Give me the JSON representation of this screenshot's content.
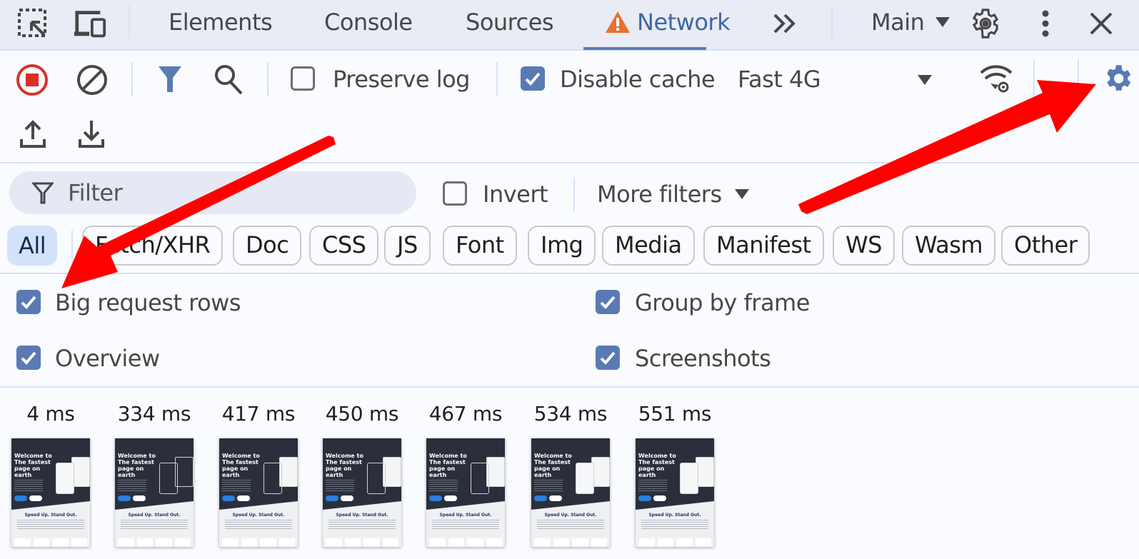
{
  "topbar": {
    "tabs": [
      {
        "label": "Elements",
        "active": false
      },
      {
        "label": "Console",
        "active": false
      },
      {
        "label": "Sources",
        "active": false
      },
      {
        "label": "Network",
        "active": true,
        "has_warning": true
      }
    ],
    "more_tabs_icon": "chevrons-right-icon",
    "target_dropdown": "Main",
    "icons": [
      "inspect-element-icon",
      "device-toolbar-icon",
      "settings-icon",
      "more-vert-icon",
      "close-icon"
    ]
  },
  "toolbar": {
    "record_icon": "stop-recording-icon",
    "clear_icon": "clear-icon",
    "filter_icon": "filter-icon",
    "search_icon": "search-icon",
    "preserve_log": {
      "label": "Preserve log",
      "checked": false
    },
    "disable_cache": {
      "label": "Disable cache",
      "checked": true
    },
    "throttling": {
      "value": "Fast 4G"
    },
    "network_conditions_icon": "wifi-settings-icon",
    "network_settings_icon": "gear-icon",
    "import_icon": "upload-icon",
    "export_icon": "download-icon"
  },
  "filters": {
    "filter_placeholder": "Filter",
    "invert": {
      "label": "Invert",
      "checked": false
    },
    "more_filters": "More filters",
    "types": [
      {
        "label": "All",
        "active": true
      },
      {
        "label": "Fetch/XHR",
        "active": false
      },
      {
        "label": "Doc",
        "active": false
      },
      {
        "label": "CSS",
        "active": false
      },
      {
        "label": "JS",
        "active": false
      },
      {
        "label": "Font",
        "active": false
      },
      {
        "label": "Img",
        "active": false
      },
      {
        "label": "Media",
        "active": false
      },
      {
        "label": "Manifest",
        "active": false
      },
      {
        "label": "WS",
        "active": false
      },
      {
        "label": "Wasm",
        "active": false
      },
      {
        "label": "Other",
        "active": false
      }
    ]
  },
  "settings": {
    "big_request_rows": {
      "label": "Big request rows",
      "checked": true
    },
    "group_by_frame": {
      "label": "Group by frame",
      "checked": true
    },
    "overview": {
      "label": "Overview",
      "checked": true
    },
    "screenshots": {
      "label": "Screenshots",
      "checked": true
    }
  },
  "filmstrip": {
    "frames": [
      {
        "time": "4 ms",
        "title": "Welcome to The fastest page on earth",
        "subtitle": "Speed Up. Stand Out.",
        "state": "full"
      },
      {
        "time": "334 ms",
        "title": "Welcome to The fastest page on earth",
        "subtitle": "Speed Up. Stand Out.",
        "state": "outline"
      },
      {
        "time": "417 ms",
        "title": "Welcome to The fastest page on earth",
        "subtitle": "Speed Up. Stand Out.",
        "state": "partial"
      },
      {
        "time": "450 ms",
        "title": "Welcome to The fastest page on earth",
        "subtitle": "Speed Up. Stand Out.",
        "state": "partial"
      },
      {
        "time": "467 ms",
        "title": "Welcome to The fastest page on earth",
        "subtitle": "Speed Up. Stand Out.",
        "state": "partial"
      },
      {
        "time": "534 ms",
        "title": "Welcome to The fastest page on earth",
        "subtitle": "Speed Up. Stand Out.",
        "state": "full"
      },
      {
        "time": "551 ms",
        "title": "Welcome to The fastest page on earth",
        "subtitle": "Speed Up. Stand Out.",
        "state": "full"
      }
    ]
  },
  "annotations": {
    "arrow_color": "#ff0000",
    "arrows": [
      "points-to-network-settings-gear",
      "points-to-big-request-rows-checkbox"
    ]
  },
  "colors": {
    "accent": "#5a7ab4",
    "active_tab_text": "#3f66a4",
    "warning": "#e8712e",
    "record": "#d93025"
  }
}
